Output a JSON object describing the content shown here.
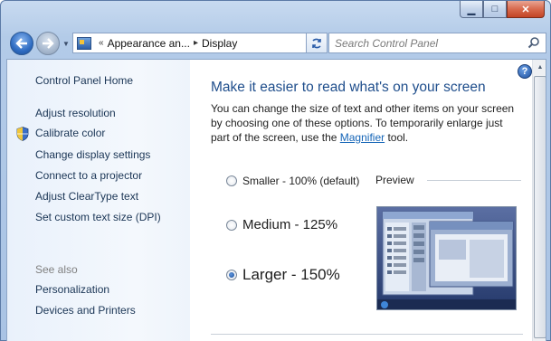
{
  "window": {
    "minimize_label": "▁",
    "maximize_label": "□",
    "close_label": "✕"
  },
  "navigation": {
    "back_icon": "back-arrow-icon",
    "forward_icon": "forward-arrow-icon",
    "breadcrumb": [
      "Appearance an...",
      "Display"
    ],
    "root_separator": "«",
    "separator": "▸",
    "search_placeholder": "Search Control Panel"
  },
  "sidebar": {
    "items": [
      {
        "label": "Control Panel Home"
      },
      {
        "label": "Adjust resolution"
      },
      {
        "label": "Calibrate color"
      },
      {
        "label": "Change display settings"
      },
      {
        "label": "Connect to a projector"
      },
      {
        "label": "Adjust ClearType text"
      },
      {
        "label": "Set custom text size (DPI)"
      }
    ],
    "see_also_label": "See also",
    "see_also_items": [
      {
        "label": "Personalization"
      },
      {
        "label": "Devices and Printers"
      }
    ]
  },
  "main": {
    "heading": "Make it easier to read what's on your screen",
    "description_before": "You can change the size of text and other items on your screen by choosing one of these options. To temporarily enlarge just part of the screen, use the ",
    "description_link": "Magnifier",
    "description_after": " tool.",
    "options": [
      {
        "label": "Smaller - 100% (default)",
        "selected": false
      },
      {
        "label": "Medium - 125%",
        "selected": false
      },
      {
        "label": "Larger - 150%",
        "selected": true
      }
    ],
    "preview_label": "Preview",
    "help_label": "?"
  },
  "colors": {
    "heading": "#1f4e8c",
    "link": "#1565b7",
    "sidebar_bg": "#eef4fb"
  }
}
